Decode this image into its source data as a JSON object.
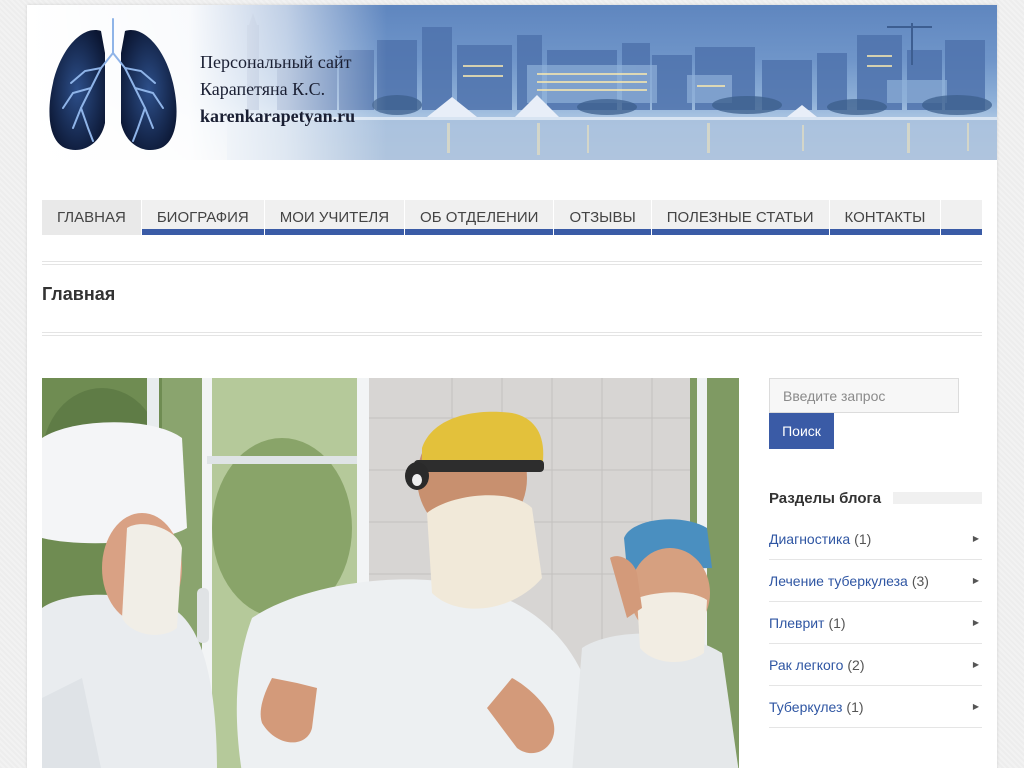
{
  "header": {
    "site_title_line1": "Персональный сайт",
    "site_title_line2": "Карапетяна К.С.",
    "site_domain": "karenkarapetyan.ru"
  },
  "nav": {
    "items": [
      {
        "label": "Главная",
        "active": true
      },
      {
        "label": "Биография"
      },
      {
        "label": "Мои учителя"
      },
      {
        "label": "Об отделении"
      },
      {
        "label": "Отзывы"
      },
      {
        "label": "Полезные статьи"
      },
      {
        "label": "Контакты"
      }
    ]
  },
  "page": {
    "title": "Главная"
  },
  "sidebar": {
    "search": {
      "placeholder": "Введите запрос",
      "button_label": "Поиск"
    },
    "categories": {
      "title": "Разделы блога",
      "items": [
        {
          "label": "Диагностика",
          "count": "(1)"
        },
        {
          "label": "Лечение туберкулеза",
          "count": "(3)"
        },
        {
          "label": "Плеврит",
          "count": "(1)"
        },
        {
          "label": "Рак легкого",
          "count": "(2)"
        },
        {
          "label": "Туберкулез",
          "count": "(1)"
        }
      ]
    }
  },
  "colors": {
    "accent": "#3a5ba6",
    "link": "#2f56a3",
    "banner_sky": "#6f95c9"
  },
  "icons": {
    "logo": "lungs-icon",
    "category_arrow": "triangle-right-icon"
  }
}
